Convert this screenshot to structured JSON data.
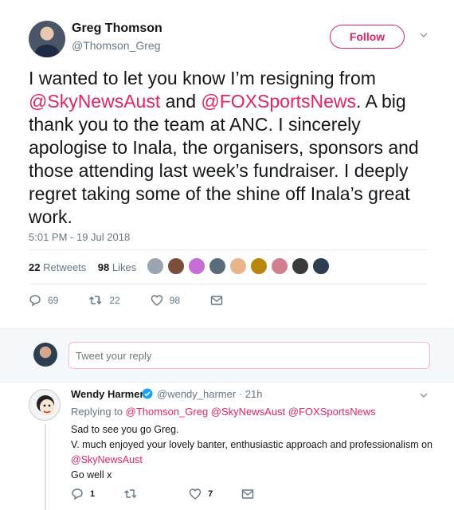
{
  "tweet": {
    "name": "Greg Thomson",
    "handle": "@Thomson_Greg",
    "follow_label": "Follow",
    "text_part1": "I wanted to let you know I’m resigning from ",
    "mention1": "@SkyNewsAust",
    "text_part2": " and ",
    "mention2": "@FOXSportsNews",
    "text_part3": ". A big thank you to the team at ANC. I sincerely apologise to Inala, the organisers, sponsors and those attending last week’s fundraiser. I deeply regret taking some of the shine off Inala’s great work.",
    "timestamp": "5:01 PM - 19 Jul 2018",
    "retweets_count": "22",
    "retweets_label": "Retweets",
    "likes_count": "98",
    "likes_label": "Likes",
    "liker_colors": [
      "#9aa5b1",
      "#7a4e3a",
      "#c86dd7",
      "#5a6b7a",
      "#e8b48a",
      "#b8860b",
      "#d08090",
      "#3a3a3a",
      "#2c3e50"
    ],
    "actions": {
      "replies": "69",
      "retweets": "22",
      "likes": "98"
    }
  },
  "reply_box": {
    "placeholder": "Tweet your reply"
  },
  "reply": {
    "name": "Wendy Harmer",
    "handle_time": "@wendy_harmer · 21h",
    "replying_prefix": "Replying to ",
    "replying_to": "@Thomson_Greg @SkyNewsAust @FOXSportsNews",
    "line1": "Sad to see you go Greg.",
    "line2": "V. much enjoyed your lovely banter, enthusiastic approach and professionalism on ",
    "line2_mention": "@SkyNewsAust",
    "line3": " Go well x",
    "actions": {
      "replies": "1",
      "retweets": "",
      "likes": "7"
    }
  },
  "colors": {
    "accent": "#e0245e",
    "muted": "#657786",
    "text": "#14171a",
    "verified": "#1da1f2"
  }
}
